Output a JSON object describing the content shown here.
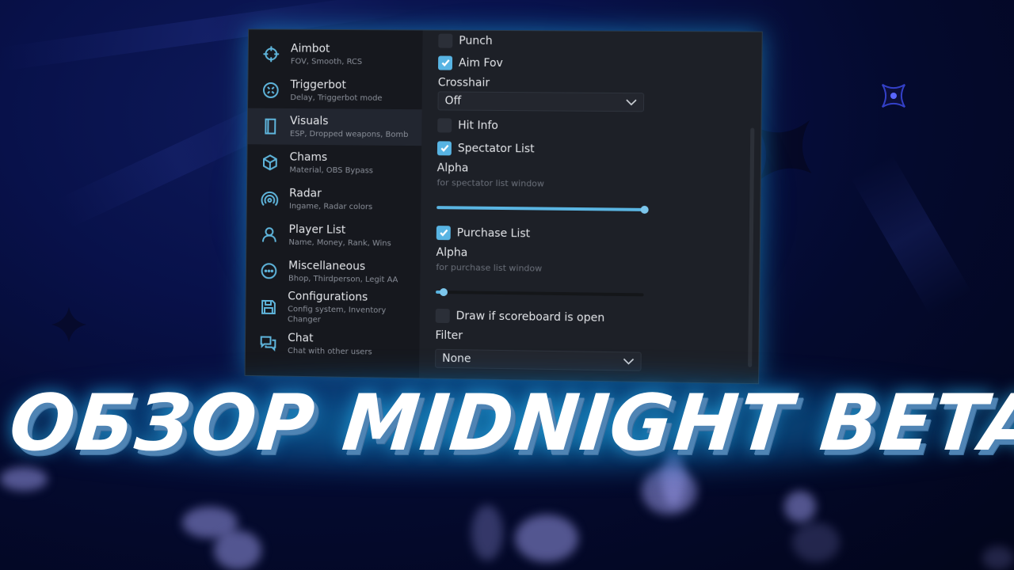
{
  "sidebar": {
    "items": [
      {
        "title": "Aimbot",
        "subtitle": "FOV, Smooth, RCS",
        "icon": "crosshair-icon"
      },
      {
        "title": "Triggerbot",
        "subtitle": "Delay, Triggerbot mode",
        "icon": "target-arrows-icon"
      },
      {
        "title": "Visuals",
        "subtitle": "ESP, Dropped weapons, Bomb",
        "icon": "panel-icon",
        "active": true
      },
      {
        "title": "Chams",
        "subtitle": "Material, OBS Bypass",
        "icon": "cube-icon"
      },
      {
        "title": "Radar",
        "subtitle": "Ingame, Radar colors",
        "icon": "radar-icon"
      },
      {
        "title": "Player List",
        "subtitle": "Name, Money, Rank, Wins",
        "icon": "user-icon"
      },
      {
        "title": "Miscellaneous",
        "subtitle": "Bhop, Thirdperson, Legit AA",
        "icon": "more-dots-icon"
      },
      {
        "title": "Configurations",
        "subtitle": "Config system, Inventory Changer",
        "icon": "save-icon"
      },
      {
        "title": "Chat",
        "subtitle": "Chat with other users",
        "icon": "chat-icon"
      }
    ]
  },
  "content": {
    "punch": {
      "label": "Punch",
      "checked": false
    },
    "aim_fov": {
      "label": "Aim Fov",
      "checked": true
    },
    "crosshair": {
      "label": "Crosshair",
      "value": "Off"
    },
    "hit_info": {
      "label": "Hit Info",
      "checked": false
    },
    "spectator_list": {
      "label": "Spectator List",
      "checked": true
    },
    "spectator_alpha": {
      "label": "Alpha",
      "description": "for spectator list window",
      "value_fraction": 1.0
    },
    "purchase_list": {
      "label": "Purchase List",
      "checked": true
    },
    "purchase_alpha": {
      "label": "Alpha",
      "description": "for purchase list window",
      "value_fraction": 0.04
    },
    "draw_scoreboard": {
      "label": "Draw if scoreboard is open",
      "checked": false
    },
    "filter": {
      "label": "Filter",
      "value": "None"
    }
  },
  "overlay": {
    "title": "ОБЗОР MIDNIGHT BETA"
  },
  "colors": {
    "accent": "#58b4e3",
    "window_bg": "#1d2027",
    "sidebar_bg": "#16181e",
    "glow": "#1e9fdc"
  }
}
